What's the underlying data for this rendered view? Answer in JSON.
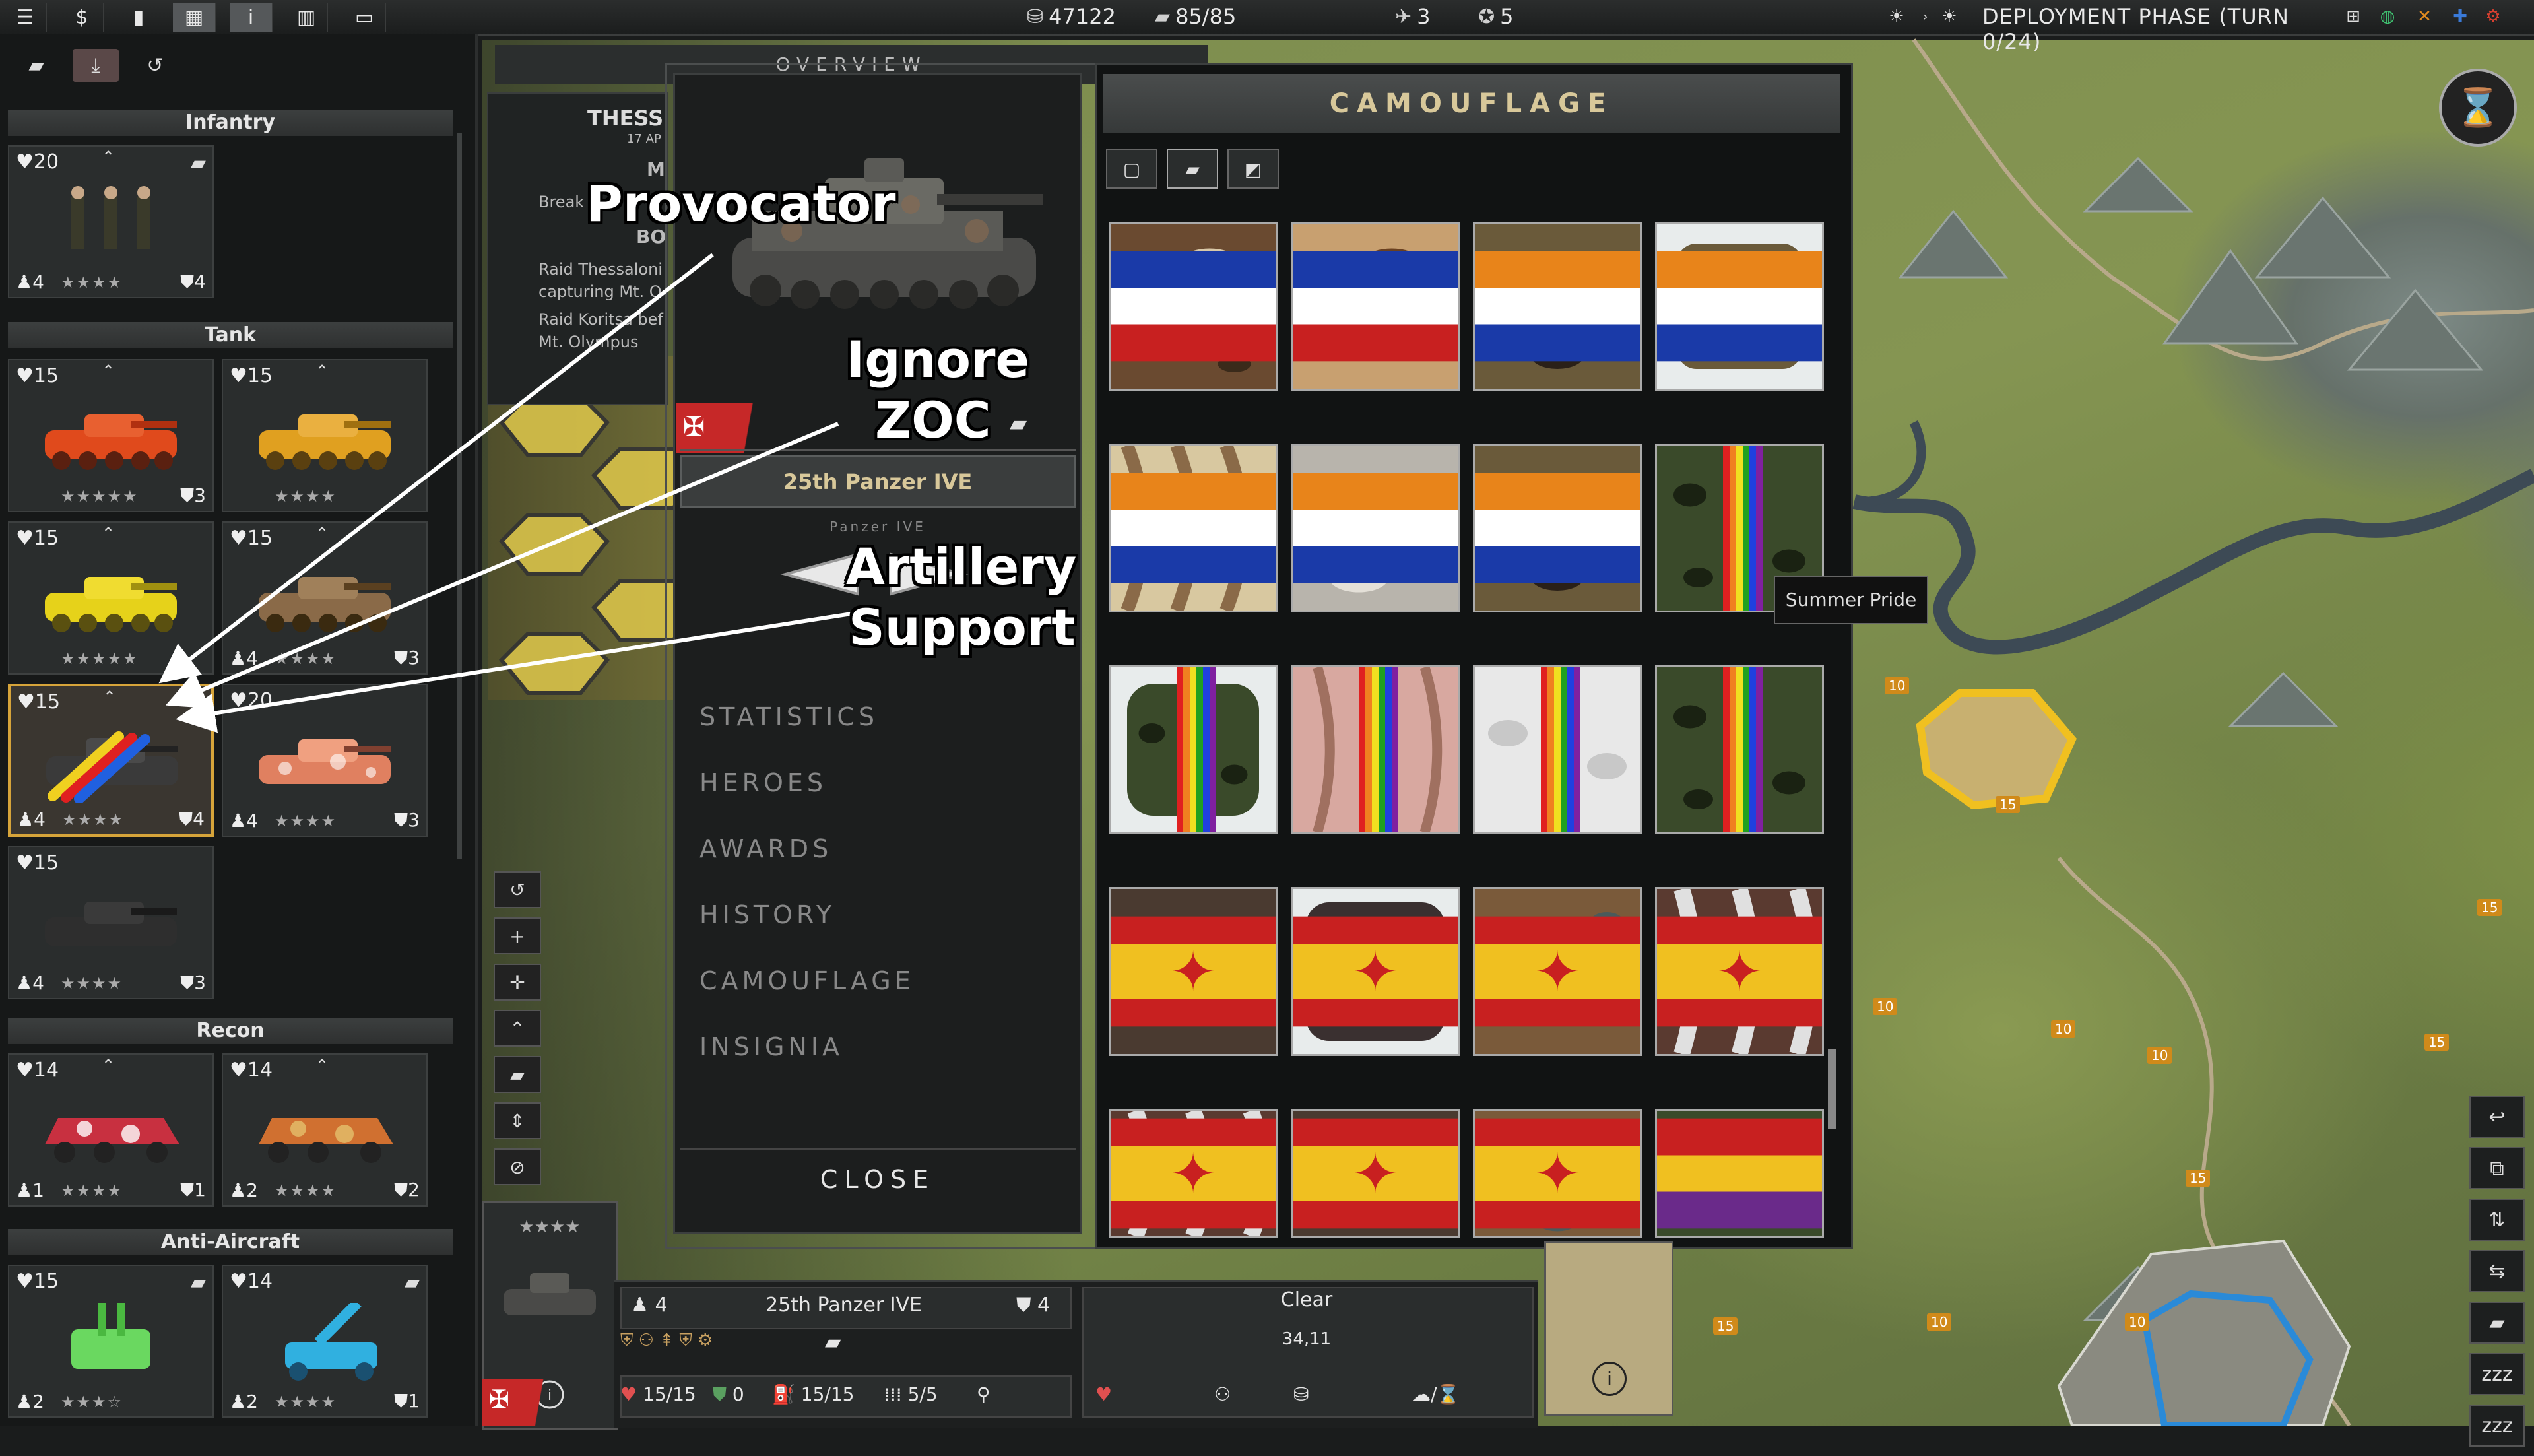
{
  "topbar": {
    "icons": [
      "menu-icon",
      "dollar-icon",
      "chat-icon",
      "grid-icon",
      "info-icon",
      "chart-icon",
      "window-icon"
    ],
    "prestige": "47122",
    "core_slots": "85/85",
    "air_slots": "3",
    "heroes": "5",
    "phase": "DEPLOYMENT PHASE (TURN 0/24)"
  },
  "left_panel": {
    "categories": {
      "infantry": "Infantry",
      "tank": "Tank",
      "recon": "Recon",
      "anti_aircraft": "Anti-Aircraft"
    },
    "cards": [
      {
        "hp": "20",
        "lvl": "4",
        "stars": "★★★★",
        "ammo": "4",
        "color": "#4a4a2e"
      },
      {
        "hp": "15",
        "lvl": "",
        "stars": "★★★★★",
        "ammo": "3",
        "color": "#e04a1c"
      },
      {
        "hp": "15",
        "lvl": "",
        "stars": "★★★★",
        "ammo": "",
        "color": "#e0a020"
      },
      {
        "hp": "15",
        "lvl": "",
        "stars": "★★★★★",
        "ammo": "",
        "color": "#e6d21a"
      },
      {
        "hp": "15",
        "lvl": "4",
        "stars": "★★★★",
        "ammo": "3",
        "color": "#8a6a48"
      },
      {
        "hp": "15",
        "lvl": "4",
        "stars": "★★★★",
        "ammo": "4",
        "color": "#3a3a3a"
      },
      {
        "hp": "20",
        "lvl": "4",
        "stars": "★★★★",
        "ammo": "3",
        "color": "#e08060"
      },
      {
        "hp": "15",
        "lvl": "4",
        "stars": "★★★★",
        "ammo": "3",
        "color": "#2e2e2e"
      },
      {
        "hp": "14",
        "lvl": "1",
        "stars": "★★★★",
        "ammo": "1",
        "color": "#c83040"
      },
      {
        "hp": "14",
        "lvl": "2",
        "stars": "★★★★",
        "ammo": "2",
        "color": "#d07030"
      },
      {
        "hp": "15",
        "lvl": "2",
        "stars": "★★★☆",
        "ammo": "",
        "color": "#6ad860"
      },
      {
        "hp": "14",
        "lvl": "2",
        "stars": "★★★★",
        "ammo": "1",
        "color": "#30b0e0"
      }
    ]
  },
  "overview": {
    "header": "OVERVIEW",
    "title": "THESS",
    "date": "17 AP",
    "lines": [
      "Break",
      "Raid Thessaloni",
      "capturing Mt. O",
      "Raid Koritsa bef",
      "Mt. Olympus"
    ],
    "letters": [
      "M",
      "BO"
    ]
  },
  "unit_window": {
    "unit_name": "25th Panzer IVE",
    "sub_name": "Panzer IVE",
    "menu": [
      "STATISTICS",
      "HEROES",
      "AWARDS",
      "HISTORY",
      "CAMOUFLAGE",
      "INSIGNIA"
    ],
    "close": "CLOSE",
    "camouflage_title": "CAMOUFLAGE",
    "tooltip": "Summer Pride"
  },
  "annotations": {
    "provocator": "Provocator",
    "ignore": "Ignore",
    "zoc": "ZOC",
    "artillery": "Artillery",
    "support": "Support"
  },
  "bottom": {
    "unit_name": "25th Panzer IVE",
    "lvl": "4",
    "ammo": "4",
    "hp": "15/15",
    "entrench": "0",
    "fuel": "15/15",
    "ammo_count": "5/5",
    "terrain": "Clear",
    "coords": "34,11"
  },
  "map": {
    "numbers": [
      "10",
      "15",
      "10",
      "10",
      "15",
      "10",
      "15",
      "15",
      "15",
      "10",
      "10"
    ]
  }
}
